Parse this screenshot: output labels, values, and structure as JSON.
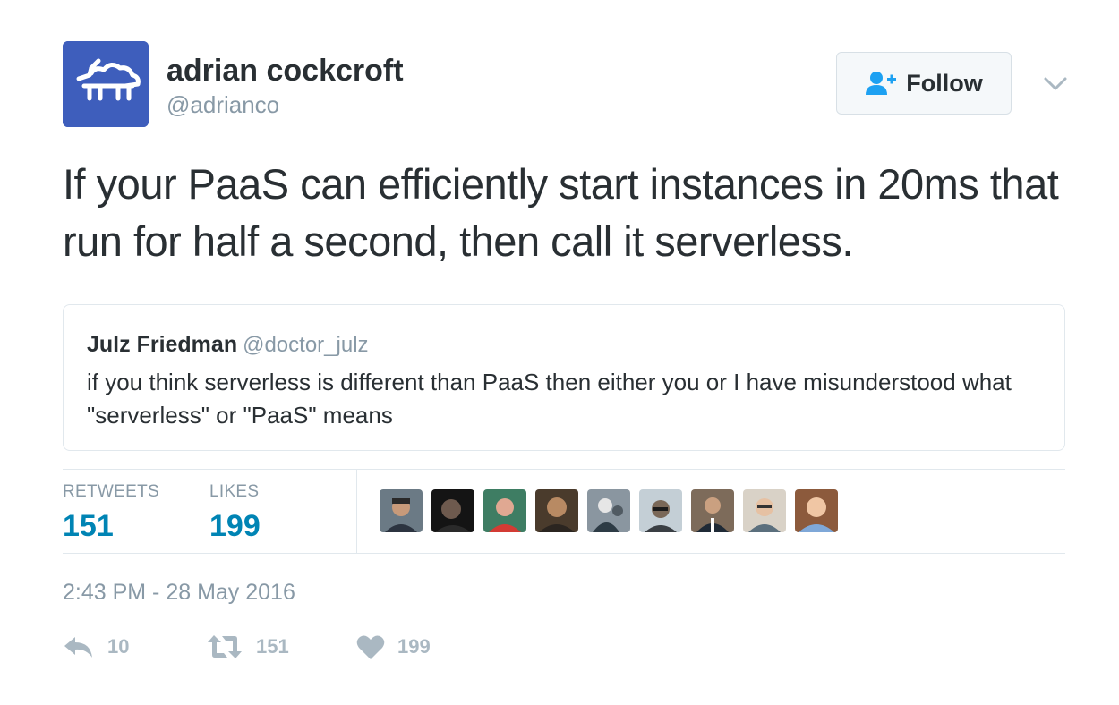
{
  "author": {
    "name": "adrian cockcroft",
    "handle": "@adrianco",
    "avatar_icon": "unicorn-cloud-icon",
    "avatar_color": "#3e5ebc"
  },
  "follow_button": {
    "label": "Follow",
    "icon": "add-user-icon"
  },
  "menu_icon": "chevron-down-icon",
  "tweet": {
    "text": "If your PaaS can efficiently start instances in 20ms that run for half a second, then call it serverless."
  },
  "quoted_tweet": {
    "name": "Julz Friedman",
    "handle": "@doctor_julz",
    "text": "if you think serverless is different than PaaS then either you or I have misunderstood what \"serverless\" or \"PaaS\" means"
  },
  "stats": {
    "retweets_label": "RETWEETS",
    "retweets_value": "151",
    "likes_label": "LIKES",
    "likes_value": "199"
  },
  "liker_avatar_count": 9,
  "timestamp": "2:43 PM - 28 May 2016",
  "actions": {
    "reply_count": "10",
    "retweet_count": "151",
    "like_count": "199"
  },
  "colors": {
    "link_blue": "#0084b4",
    "muted_gray": "#8899a6",
    "action_gray": "#aab8c2",
    "follow_icon_blue": "#1da1f2"
  }
}
